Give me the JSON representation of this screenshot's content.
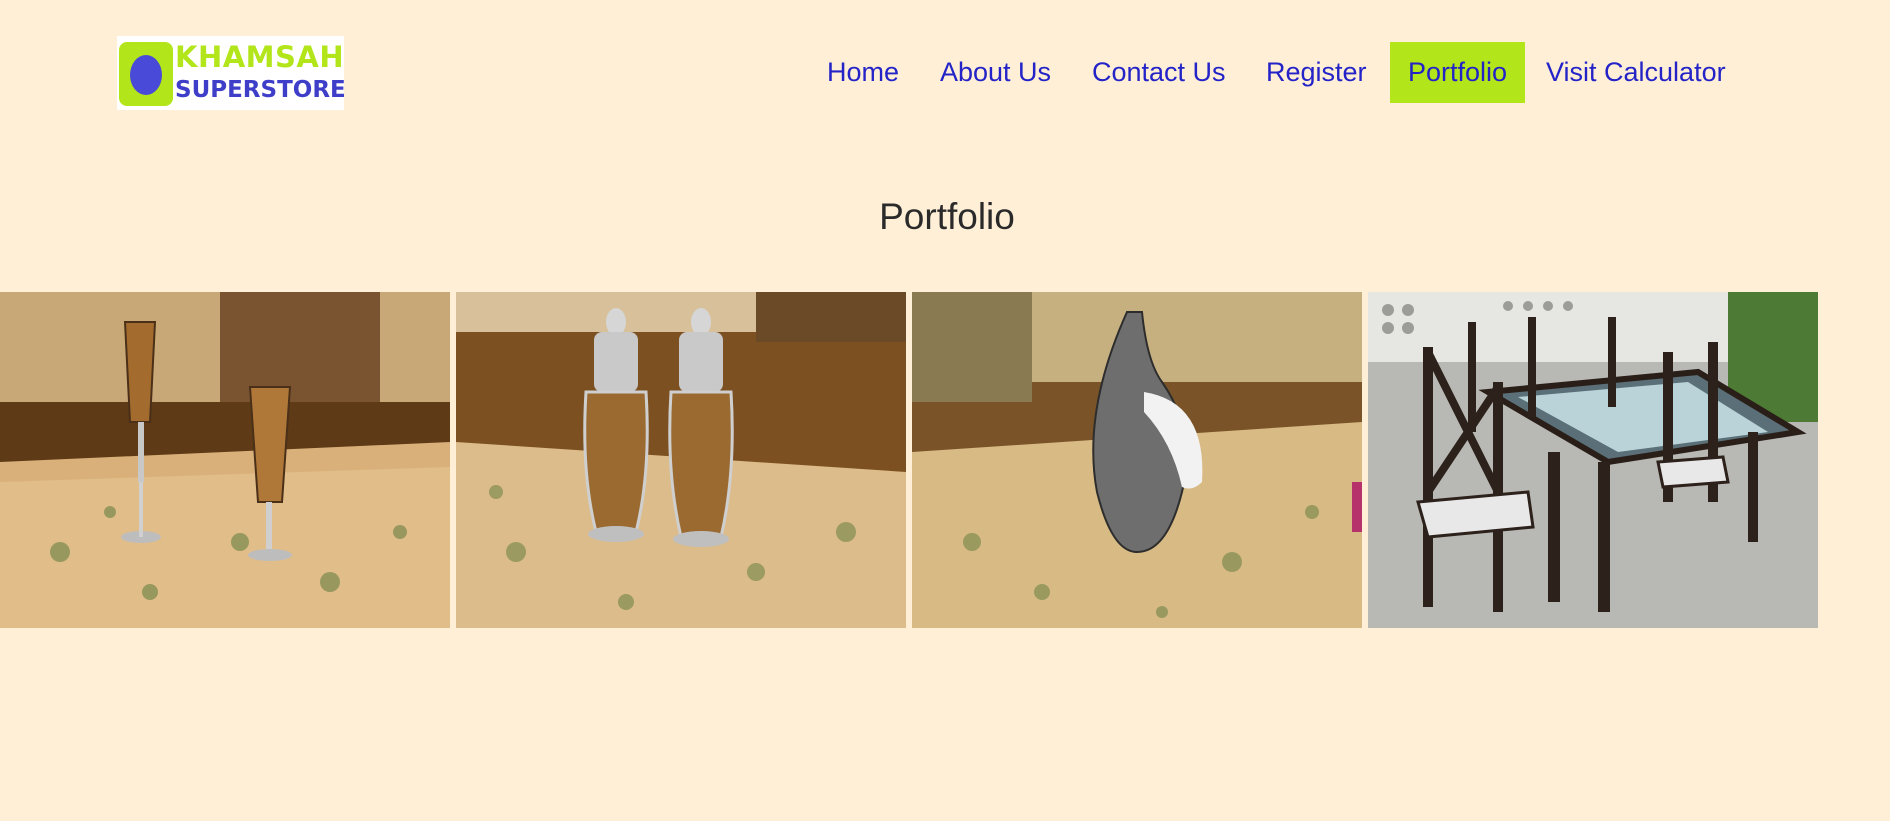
{
  "header": {
    "logo": {
      "line1": "KHAMSAH",
      "line2": "SUPERSTORE"
    },
    "nav": [
      {
        "label": "Home"
      },
      {
        "label": "About Us"
      },
      {
        "label": "Contact Us"
      },
      {
        "label": "Register"
      },
      {
        "label": "Portfolio",
        "active": true
      },
      {
        "label": "Visit Calculator"
      }
    ]
  },
  "main": {
    "title": "Portfolio",
    "gallery": [
      {
        "subject": "two amber glass goblets on a carpet"
      },
      {
        "subject": "two lidded glass jars with silver tops on a carpet"
      },
      {
        "subject": "chrome crescent sculpture on a carpet"
      },
      {
        "subject": "dark wood dining set with glass table top outdoors"
      }
    ]
  },
  "colors": {
    "page_background": "#ffefd6",
    "nav_text": "#2323c8",
    "active_nav_background": "#b3e51b",
    "logo_green": "#b3e51b",
    "logo_blue": "#3e3ec9"
  }
}
